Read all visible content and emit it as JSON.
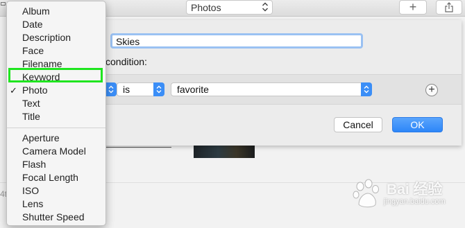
{
  "toolbar": {
    "library_select": "Photos",
    "add_label": "+"
  },
  "background": {
    "partial_text": "4t"
  },
  "sheet": {
    "album_name": "Skies",
    "condition_label": "condition:",
    "condition": {
      "operator": "is",
      "value": "favorite"
    },
    "add_condition_label": "+",
    "cancel_label": "Cancel",
    "ok_label": "OK"
  },
  "menu": {
    "items": [
      {
        "label": "Album"
      },
      {
        "label": "Date"
      },
      {
        "label": "Description"
      },
      {
        "label": "Face"
      },
      {
        "label": "Filename"
      },
      {
        "label": "Keyword",
        "highlighted": true
      },
      {
        "label": "Photo",
        "checked": true
      },
      {
        "label": "Text"
      },
      {
        "label": "Title"
      },
      {
        "label": "Aperture"
      },
      {
        "label": "Camera Model"
      },
      {
        "label": "Flash"
      },
      {
        "label": "Focal Length"
      },
      {
        "label": "ISO"
      },
      {
        "label": "Lens"
      },
      {
        "label": "Shutter Speed"
      }
    ],
    "check_mark": "✓"
  },
  "watermark": {
    "text": "Bai 经验",
    "url": "jingyan.baidu.com"
  },
  "colors": {
    "accent": "#3b8ef7",
    "highlight_box": "#1fe51f"
  }
}
